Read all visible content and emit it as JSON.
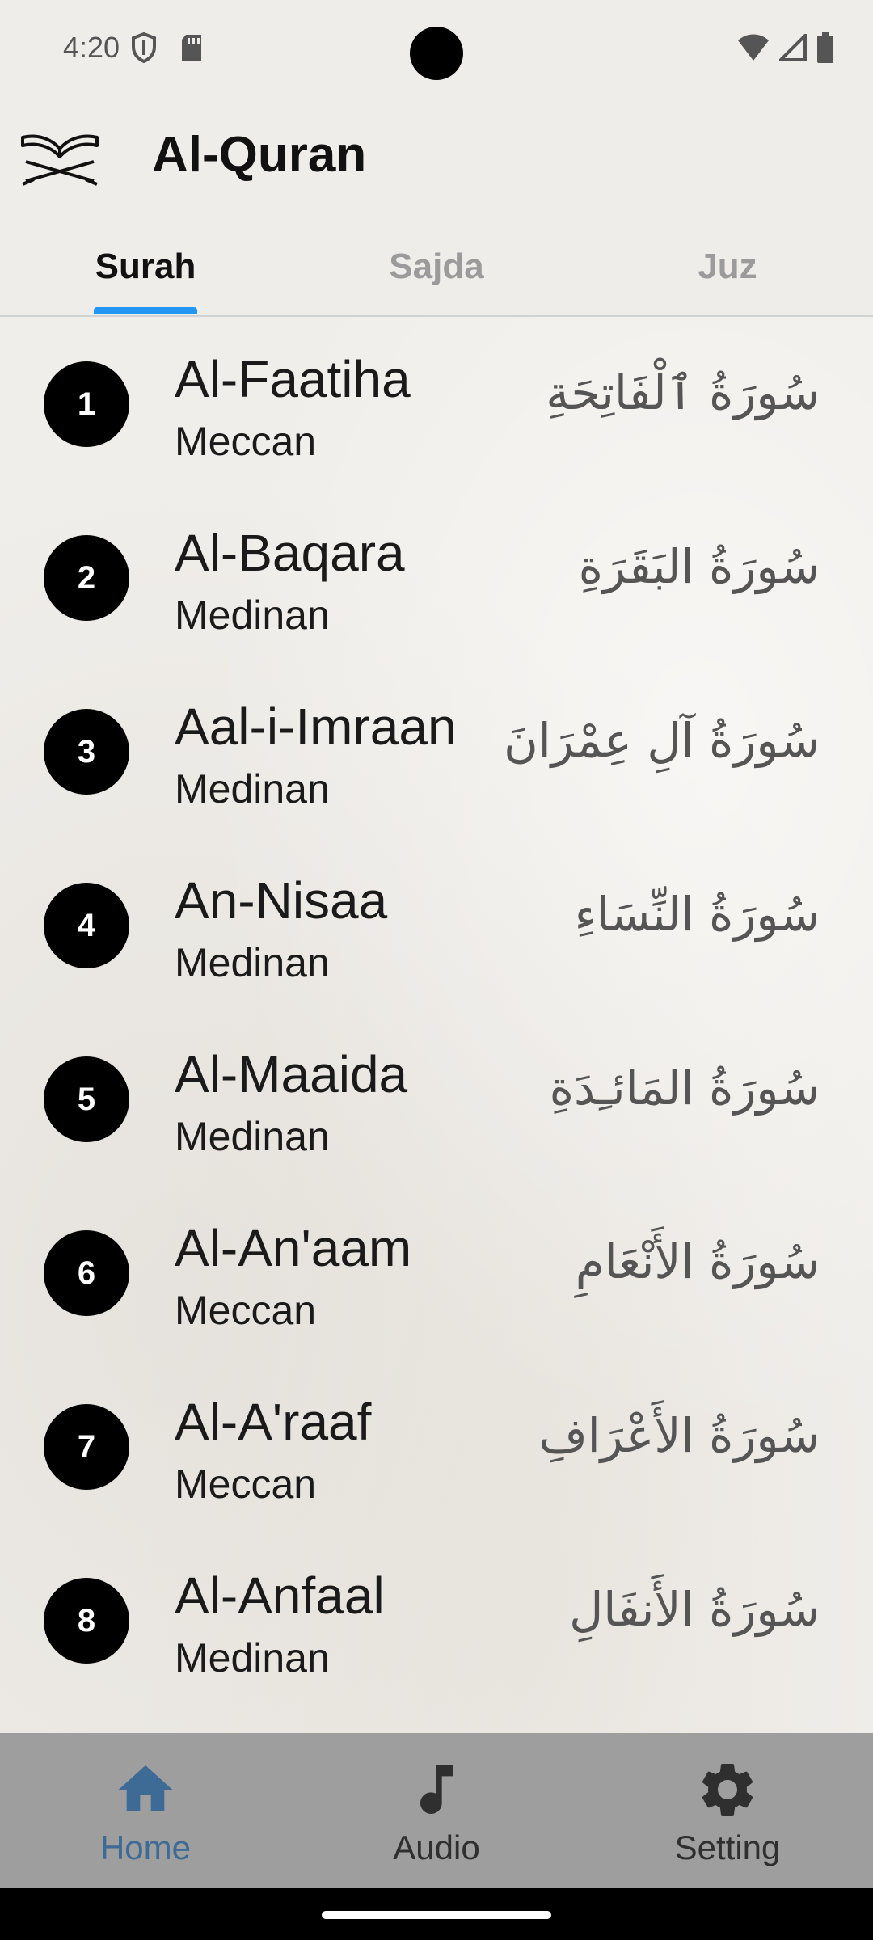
{
  "status_bar": {
    "time": "4:20",
    "icons": [
      "shield-icon",
      "sd-card-icon",
      "wifi-icon",
      "cell-signal-icon",
      "battery-icon"
    ]
  },
  "app_bar": {
    "title": "Al-Quran",
    "logo_icon": "quran-book-icon"
  },
  "tabs": [
    {
      "label": "Surah",
      "active": true
    },
    {
      "label": "Sajda",
      "active": false
    },
    {
      "label": "Juz",
      "active": false
    }
  ],
  "accent_color": "#2196f3",
  "surahs": [
    {
      "number": "1",
      "name": "Al-Faatiha",
      "type": "Meccan",
      "arabic": "سُورَةُ ٱلْفَاتِحَةِ"
    },
    {
      "number": "2",
      "name": "Al-Baqara",
      "type": "Medinan",
      "arabic": "سُورَةُ البَقَرَةِ"
    },
    {
      "number": "3",
      "name": "Aal-i-Imraan",
      "type": "Medinan",
      "arabic": "سُورَةُ آلِ عِمْرَانَ"
    },
    {
      "number": "4",
      "name": "An-Nisaa",
      "type": "Medinan",
      "arabic": "سُورَةُ النِّسَاءِ"
    },
    {
      "number": "5",
      "name": "Al-Maaida",
      "type": "Medinan",
      "arabic": "سُورَةُ المَائـِدَةِ"
    },
    {
      "number": "6",
      "name": "Al-An'aam",
      "type": "Meccan",
      "arabic": "سُورَةُ الأَنْعَامِ"
    },
    {
      "number": "7",
      "name": "Al-A'raaf",
      "type": "Meccan",
      "arabic": "سُورَةُ الأَعْرَافِ"
    },
    {
      "number": "8",
      "name": "Al-Anfaal",
      "type": "Medinan",
      "arabic": "سُورَةُ الأَنفَالِ"
    }
  ],
  "bottom_nav": [
    {
      "label": "Home",
      "icon": "home-icon",
      "active": true
    },
    {
      "label": "Audio",
      "icon": "music-note-icon",
      "active": false
    },
    {
      "label": "Setting",
      "icon": "gear-icon",
      "active": false
    }
  ]
}
